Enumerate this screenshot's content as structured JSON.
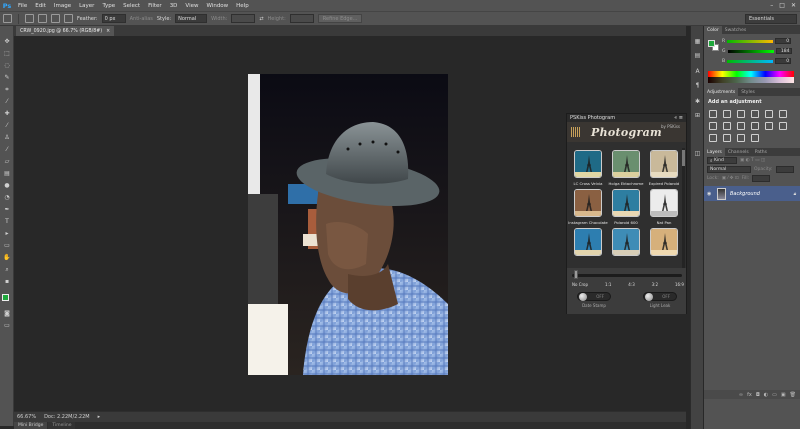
{
  "menubar": {
    "app_logo": "Ps",
    "items": [
      "File",
      "Edit",
      "Image",
      "Layer",
      "Type",
      "Select",
      "Filter",
      "3D",
      "View",
      "Window",
      "Help"
    ],
    "window_controls": [
      "–",
      "□",
      "✕"
    ]
  },
  "optbar": {
    "feather_label": "Feather:",
    "feather_value": "0 px",
    "antialias_label": "Anti-alias",
    "style_label": "Style:",
    "style_value": "Normal",
    "width_label": "Width:",
    "height_label": "Height:",
    "refine_button": "Refine Edge...",
    "workspace": "Essentials"
  },
  "document": {
    "tab_title": "CRW_0920.jpg @ 66.7% (RGB/8#)",
    "close": "×"
  },
  "status": {
    "zoom": "66.67%",
    "doc_size": "Doc: 2.22M/2.22M"
  },
  "bottom_tabs": [
    "Mini Bridge",
    "Timeline"
  ],
  "photogram": {
    "panel_title": "PSKiss Photogram",
    "logo": "Photogram",
    "byline": "by PSKiss",
    "filters": [
      {
        "label": "LC Cross Velvia",
        "sky": "#1f6a86",
        "ground": "#e1d7a4"
      },
      {
        "label": "Holga Ektachrome",
        "sky": "#6a8f6f",
        "ground": "#dcd09e"
      },
      {
        "label": "Expired Polaroid",
        "sky": "#c9b99a",
        "ground": "#e7dbc0"
      },
      {
        "label": "Instagram Chocolate",
        "sky": "#8a6042",
        "ground": "#d9b98d"
      },
      {
        "label": "Polaroid 600",
        "sky": "#2e7ea1",
        "ground": "#e9d8b3"
      },
      {
        "label": "Nat Pan",
        "sky": "#ececec",
        "ground": "#bdbdbd"
      },
      {
        "label": "",
        "sky": "#2d7eb0",
        "ground": "#e2d4ad"
      },
      {
        "label": "",
        "sky": "#3e8cb6",
        "ground": "#d7cdb6"
      },
      {
        "label": "",
        "sky": "#d6b07b",
        "ground": "#efd9b0"
      }
    ],
    "crop_options": [
      "No Crop",
      "1:1",
      "4:3",
      "3:2",
      "16:9"
    ],
    "toggles": [
      {
        "state": "OFF",
        "label": "Date Stamp"
      },
      {
        "state": "OFF",
        "label": "Light Leak"
      }
    ]
  },
  "panels": {
    "color_tabs": [
      "Color",
      "Swatches"
    ],
    "color_channels": [
      {
        "name": "R",
        "value": "0"
      },
      {
        "name": "G",
        "value": "184"
      },
      {
        "name": "B",
        "value": "0"
      }
    ],
    "adjustment_tabs": [
      "Adjustments",
      "Styles"
    ],
    "adjustment_title": "Add an adjustment",
    "layers_tabs": [
      "Layers",
      "Channels",
      "Paths"
    ],
    "kind_label": "Kind",
    "blend_mode": "Normal",
    "opacity_label": "Opacity:",
    "lock_label": "Lock:",
    "fill_label": "Fill:",
    "layer_name": "Background"
  },
  "colors": {
    "foreground": "#1fa83c",
    "background": "#ffffff",
    "layer_selected": "#4a5f8c"
  }
}
